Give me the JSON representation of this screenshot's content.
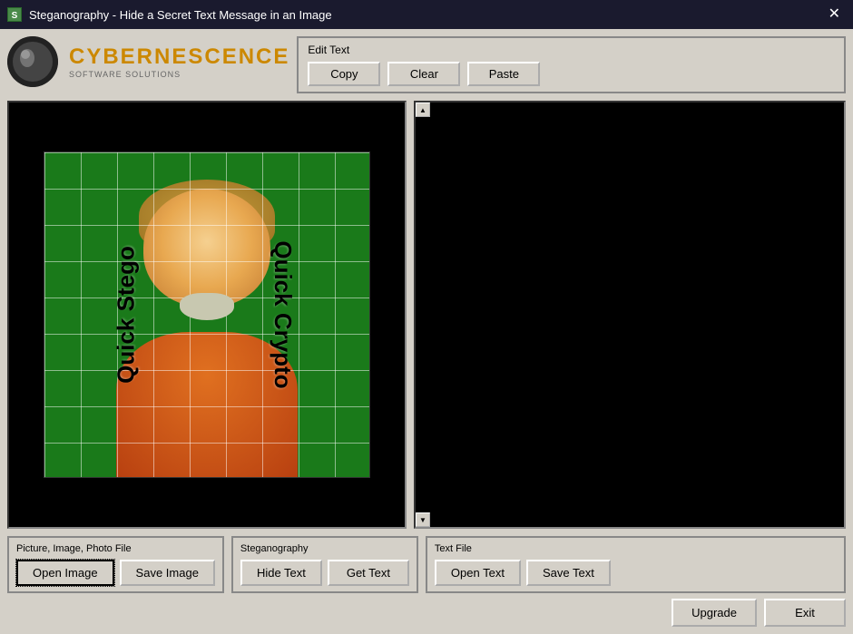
{
  "titlebar": {
    "title": "Steganography - Hide a Secret Text Message in an Image",
    "close_label": "✕"
  },
  "logo": {
    "title": "CYBERNESCENCE",
    "subtitle": "SOFTWARE SOLUTIONS"
  },
  "edit_text_panel": {
    "label": "Edit Text",
    "copy_label": "Copy",
    "clear_label": "Clear",
    "paste_label": "Paste"
  },
  "image_watermarks": {
    "left": "Quick Stego",
    "right": "Quick Crypto"
  },
  "picture_panel": {
    "label": "Picture, Image, Photo File",
    "open_label": "Open Image",
    "save_label": "Save Image"
  },
  "stego_panel": {
    "label": "Steganography",
    "hide_label": "Hide Text",
    "get_label": "Get Text"
  },
  "text_file_panel": {
    "label": "Text File",
    "open_label": "Open Text",
    "save_label": "Save Text"
  },
  "footer": {
    "upgrade_label": "Upgrade",
    "exit_label": "Exit"
  }
}
